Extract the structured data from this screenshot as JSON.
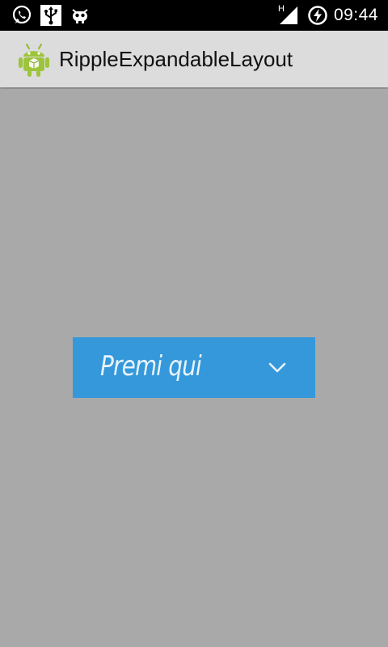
{
  "status_bar": {
    "time": "09:44",
    "network_type": "H",
    "icons": [
      "whatsapp-icon",
      "usb-icon",
      "cyanogen-icon",
      "signal-icon",
      "battery-charging-icon"
    ]
  },
  "action_bar": {
    "title": "RippleExpandableLayout",
    "app_icon": "android-robot-icon"
  },
  "content": {
    "expand_button": {
      "label": "Premi qui",
      "icon": "chevron-down-icon",
      "color": "#3498db"
    }
  },
  "colors": {
    "background": "#a9a9a9",
    "action_bar": "#dcdcdc",
    "status_bar": "#000000"
  }
}
